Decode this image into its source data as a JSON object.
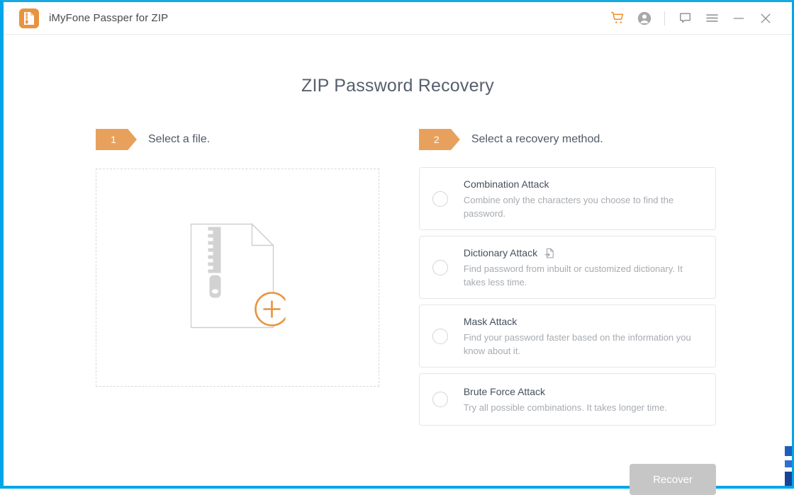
{
  "window": {
    "frame_color": "#00a6e8",
    "title": "iMyFone Passper for ZIP",
    "app_icon": "zip-file-icon"
  },
  "titlebar_actions": [
    {
      "name": "cart-icon",
      "label": "Cart",
      "color": "#ef8f2e"
    },
    {
      "name": "account-icon",
      "label": "Account",
      "color": "#9a9a9a"
    },
    {
      "name": "feedback-icon",
      "label": "Feedback",
      "color": "#8b8b8b"
    },
    {
      "name": "menu-icon",
      "label": "Menu",
      "color": "#8b8b8b"
    },
    {
      "name": "minimize-button",
      "label": "Minimize",
      "color": "#8b8b8b"
    },
    {
      "name": "close-button",
      "label": "Close",
      "color": "#8b8b8b"
    }
  ],
  "page": {
    "title": "ZIP Password Recovery",
    "accent_color": "#e8a15c"
  },
  "step_one": {
    "number": "1",
    "label": "Select a file.",
    "dropzone_icon": "zip-file-add-icon",
    "add_badge": "+"
  },
  "step_two": {
    "number": "2",
    "label": "Select a recovery method.",
    "methods": [
      {
        "title": "Combination Attack",
        "description": "Combine only the characters you choose to find the password.",
        "selected": false,
        "icon": ""
      },
      {
        "title": "Dictionary Attack",
        "description": "Find password from inbuilt or customized dictionary. It takes less time.",
        "selected": false,
        "icon": "import-dictionary-icon"
      },
      {
        "title": "Mask Attack",
        "description": "Find your password faster based on the information you know about it.",
        "selected": false,
        "icon": ""
      },
      {
        "title": "Brute Force Attack",
        "description": "Try all possible combinations. It takes longer time.",
        "selected": false,
        "icon": ""
      }
    ]
  },
  "footer": {
    "recover_label": "Recover",
    "recover_enabled": false,
    "recover_color": "#c6c6c6"
  }
}
